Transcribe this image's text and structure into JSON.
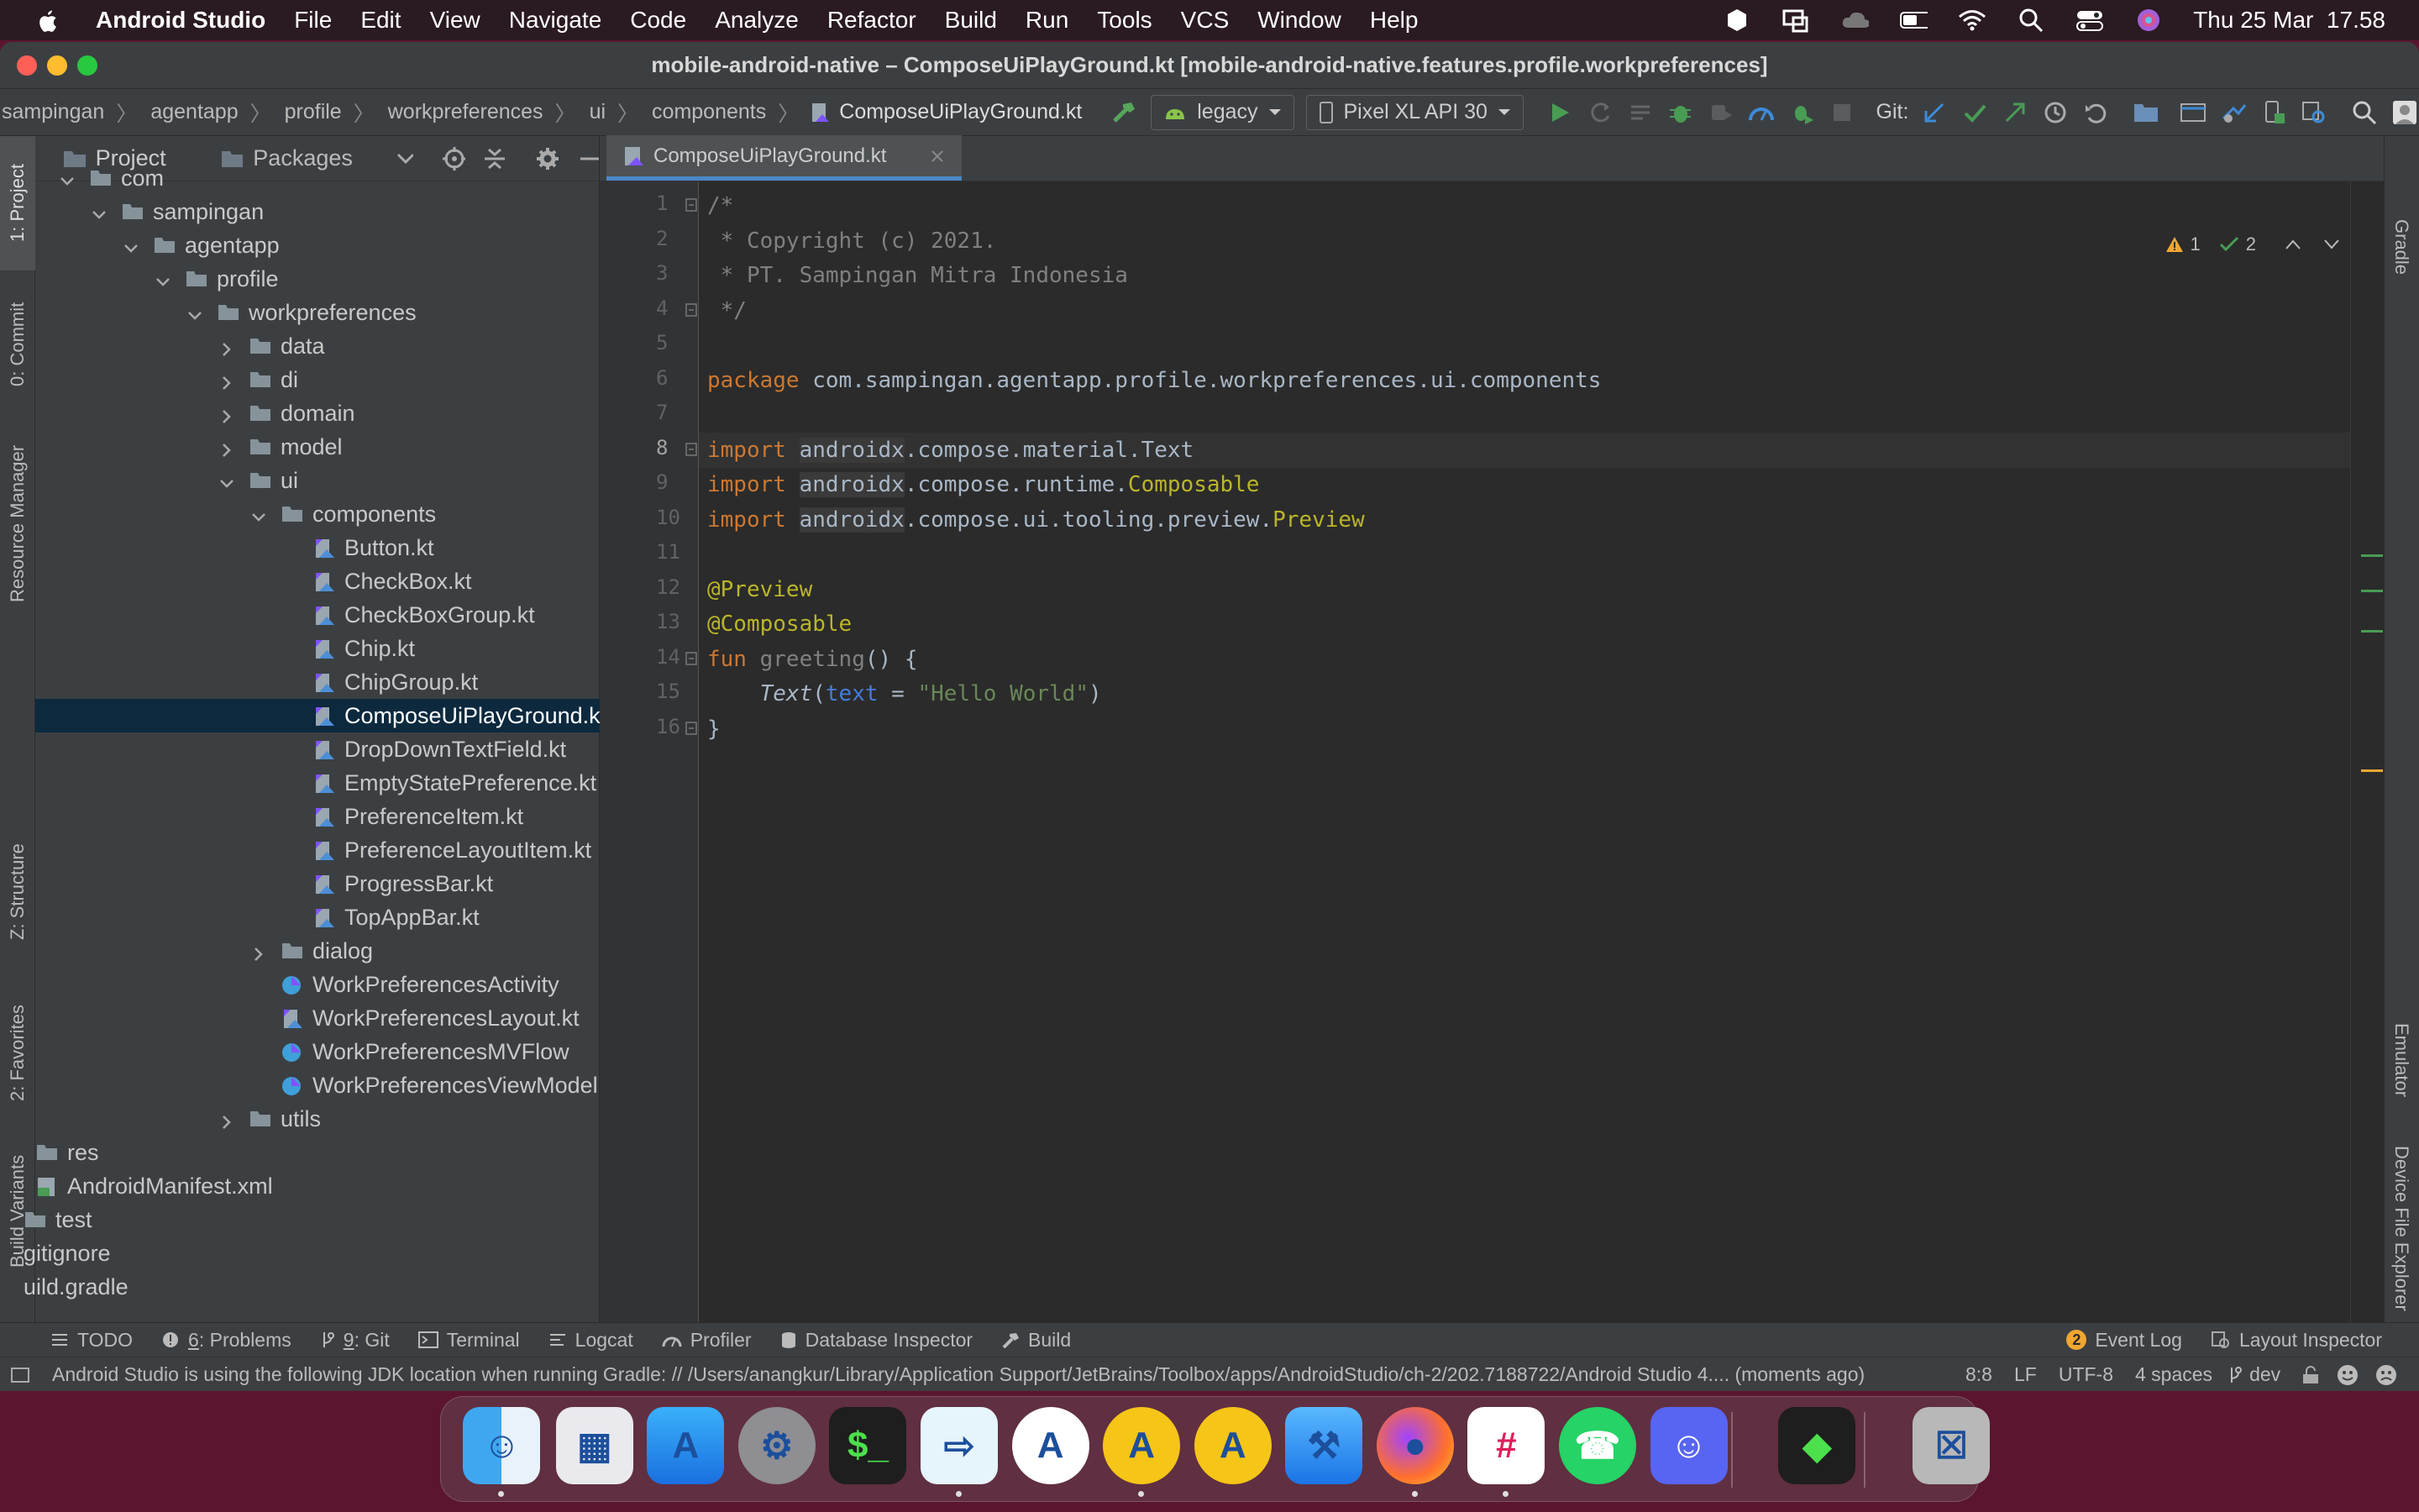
{
  "menubar": {
    "app_name": "Android Studio",
    "items": [
      "File",
      "Edit",
      "View",
      "Navigate",
      "Code",
      "Analyze",
      "Refactor",
      "Build",
      "Run",
      "Tools",
      "VCS",
      "Window",
      "Help"
    ],
    "clock": "Thu 25 Mar  17.58"
  },
  "window": {
    "title": "mobile-android-native – ComposeUiPlayGround.kt [mobile-android-native.features.profile.workpreferences]"
  },
  "navbar": {
    "breadcrumbs": [
      "sampingan",
      "agentapp",
      "profile",
      "workpreferences",
      "ui",
      "components",
      "ComposeUiPlayGround.kt"
    ],
    "run_config": "legacy",
    "device": "Pixel XL API 30",
    "git_label": "Git:"
  },
  "left_tabs": [
    "1: Project",
    "0: Commit",
    "Resource Manager",
    "Z: Structure",
    "2: Favorites",
    "Build Variants"
  ],
  "right_tabs": [
    "Gradle",
    "Emulator",
    "Device File Explorer"
  ],
  "project": {
    "tab_project": "Project",
    "tab_packages": "Packages",
    "tree": [
      {
        "label": "com",
        "depth": 0,
        "kind": "folder",
        "open": true
      },
      {
        "label": "sampingan",
        "depth": 1,
        "kind": "folder",
        "open": true
      },
      {
        "label": "agentapp",
        "depth": 2,
        "kind": "folder",
        "open": true
      },
      {
        "label": "profile",
        "depth": 3,
        "kind": "folder",
        "open": true
      },
      {
        "label": "workpreferences",
        "depth": 4,
        "kind": "folder",
        "open": true
      },
      {
        "label": "data",
        "depth": 5,
        "kind": "folder",
        "open": false
      },
      {
        "label": "di",
        "depth": 5,
        "kind": "folder",
        "open": false
      },
      {
        "label": "domain",
        "depth": 5,
        "kind": "folder",
        "open": false
      },
      {
        "label": "model",
        "depth": 5,
        "kind": "folder",
        "open": false
      },
      {
        "label": "ui",
        "depth": 5,
        "kind": "folder",
        "open": true
      },
      {
        "label": "components",
        "depth": 6,
        "kind": "folder",
        "open": true
      },
      {
        "label": "Button.kt",
        "depth": 7,
        "kind": "kt"
      },
      {
        "label": "CheckBox.kt",
        "depth": 7,
        "kind": "kt"
      },
      {
        "label": "CheckBoxGroup.kt",
        "depth": 7,
        "kind": "kt"
      },
      {
        "label": "Chip.kt",
        "depth": 7,
        "kind": "kt"
      },
      {
        "label": "ChipGroup.kt",
        "depth": 7,
        "kind": "kt"
      },
      {
        "label": "ComposeUiPlayGround.kt",
        "depth": 7,
        "kind": "kt",
        "selected": true
      },
      {
        "label": "DropDownTextField.kt",
        "depth": 7,
        "kind": "kt"
      },
      {
        "label": "EmptyStatePreference.kt",
        "depth": 7,
        "kind": "kt"
      },
      {
        "label": "PreferenceItem.kt",
        "depth": 7,
        "kind": "kt"
      },
      {
        "label": "PreferenceLayoutItem.kt",
        "depth": 7,
        "kind": "kt"
      },
      {
        "label": "ProgressBar.kt",
        "depth": 7,
        "kind": "kt"
      },
      {
        "label": "TopAppBar.kt",
        "depth": 7,
        "kind": "kt"
      },
      {
        "label": "dialog",
        "depth": 6,
        "kind": "folder",
        "open": false
      },
      {
        "label": "WorkPreferencesActivity",
        "depth": 6,
        "kind": "class"
      },
      {
        "label": "WorkPreferencesLayout.kt",
        "depth": 6,
        "kind": "kt"
      },
      {
        "label": "WorkPreferencesMVFlow",
        "depth": 6,
        "kind": "class"
      },
      {
        "label": "WorkPreferencesViewModel",
        "depth": 6,
        "kind": "class"
      },
      {
        "label": "utils",
        "depth": 5,
        "kind": "folder",
        "open": false
      },
      {
        "label": "res",
        "depth": -1,
        "kind": "folder"
      },
      {
        "label": "AndroidManifest.xml",
        "depth": -1,
        "kind": "xml"
      },
      {
        "label": "test",
        "depth": -2,
        "kind": "folder"
      },
      {
        "label": "gitignore",
        "depth": -2,
        "kind": "plain"
      },
      {
        "label": "uild.gradle",
        "depth": -2,
        "kind": "plain"
      }
    ]
  },
  "editor": {
    "tab_label": "ComposeUiPlayGround.kt",
    "warnings": "1",
    "checks": "2",
    "code": [
      {
        "n": "1",
        "html": "<span class='cm'>/*</span>"
      },
      {
        "n": "2",
        "html": "<span class='cm'> * Copyright (c) 2021.</span>"
      },
      {
        "n": "3",
        "html": "<span class='cm'> * PT. Sampingan Mitra Indonesia</span>"
      },
      {
        "n": "4",
        "html": "<span class='cm'> */</span>"
      },
      {
        "n": "5",
        "html": ""
      },
      {
        "n": "6",
        "html": "<span class='kw'>package</span> com.sampingan.agentapp.profile.workpreferences.ui.components"
      },
      {
        "n": "7",
        "html": ""
      },
      {
        "n": "8",
        "html": "<span class='kw'>import</span> <span class='dimbg'>androidx</span>.compose.material.Text"
      },
      {
        "n": "9",
        "html": "<span class='kw'>import</span> <span class='dimbg'>androidx</span>.compose.runtime.<span class='ann'>Composable</span>"
      },
      {
        "n": "10",
        "html": "<span class='kw'>import</span> <span class='dimbg'>androidx</span>.compose.ui.tooling.preview.<span class='ann'>Preview</span>"
      },
      {
        "n": "11",
        "html": ""
      },
      {
        "n": "12",
        "html": "<span class='ann'>@Preview</span>"
      },
      {
        "n": "13",
        "html": "<span class='ann'>@Composable</span>"
      },
      {
        "n": "14",
        "html": "<span class='kw'>fun</span> <span class='unused'>greeting</span>() {"
      },
      {
        "n": "15",
        "html": "    <span class='ital'>Text</span>(<span class='par'>text</span> = <span class='str'>\"Hello World\"</span>)"
      },
      {
        "n": "16",
        "html": "}"
      }
    ]
  },
  "toolwindows": [
    {
      "label": "TODO",
      "key": ""
    },
    {
      "label": "Problems",
      "key": "6"
    },
    {
      "label": "Git",
      "key": "9"
    },
    {
      "label": "Terminal",
      "key": ""
    },
    {
      "label": "Logcat",
      "key": ""
    },
    {
      "label": "Profiler",
      "key": ""
    },
    {
      "label": "Database Inspector",
      "key": ""
    },
    {
      "label": "Build",
      "key": ""
    }
  ],
  "event_log": {
    "count": "2",
    "label": "Event Log"
  },
  "layout_inspector": "Layout Inspector",
  "status": {
    "message": "Android Studio is using the following JDK location when running Gradle: // /Users/anangkur/Library/Application Support/JetBrains/Toolbox/apps/AndroidStudio/ch-2/202.7188722/Android Studio 4.... (moments ago)",
    "position": "8:8",
    "line_sep": "LF",
    "encoding": "UTF-8",
    "indent": "4 spaces",
    "branch": "dev"
  },
  "dock_apps": [
    "Finder",
    "Launchpad",
    "App Store",
    "System Preferences",
    "Terminal",
    "Migration",
    "Android Studio",
    "Android Studio Beta",
    "Android Studio Preview",
    "Xcode",
    "Firefox",
    "Slack",
    "WhatsApp",
    "Discord",
    "Figma",
    "Trash"
  ]
}
